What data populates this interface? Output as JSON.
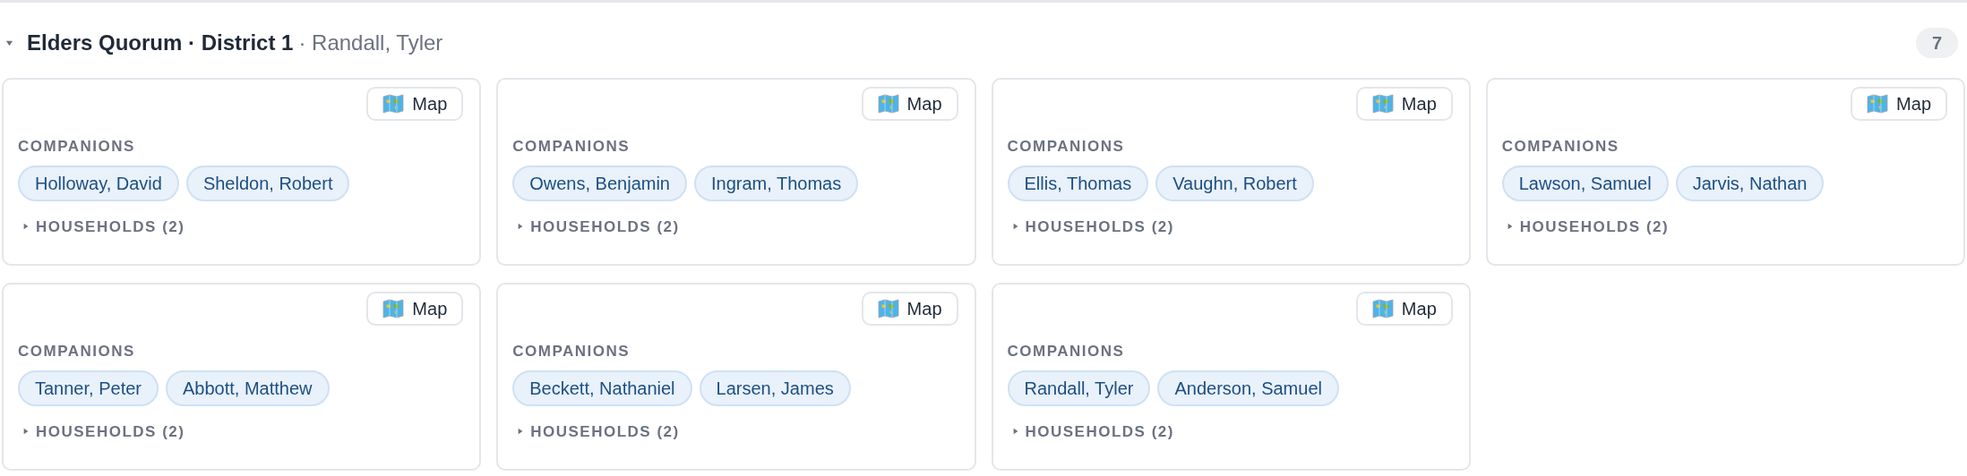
{
  "group": {
    "expanded": true,
    "title": "Elders Quorum · District 1",
    "leader": "· Randall, Tyler",
    "count": "7"
  },
  "cards": [
    {
      "map_label": "Map",
      "companions_label": "COMPANIONS",
      "companions": [
        "Holloway, David",
        "Sheldon, Robert"
      ],
      "households": {
        "label": "HOUSEHOLDS (2)",
        "expanded": false
      }
    },
    {
      "map_label": "Map",
      "companions_label": "COMPANIONS",
      "companions": [
        "Owens, Benjamin",
        "Ingram, Thomas"
      ],
      "households": {
        "label": "HOUSEHOLDS (2)",
        "expanded": false
      }
    },
    {
      "map_label": "Map",
      "companions_label": "COMPANIONS",
      "companions": [
        "Ellis, Thomas",
        "Vaughn, Robert"
      ],
      "households": {
        "label": "HOUSEHOLDS (2)",
        "expanded": false
      }
    },
    {
      "map_label": "Map",
      "companions_label": "COMPANIONS",
      "companions": [
        "Lawson, Samuel",
        "Jarvis, Nathan"
      ],
      "households": {
        "label": "HOUSEHOLDS (2)",
        "expanded": false
      }
    },
    {
      "map_label": "Map",
      "companions_label": "COMPANIONS",
      "companions": [
        "Tanner, Peter",
        "Abbott, Matthew"
      ],
      "households": {
        "label": "HOUSEHOLDS (2)",
        "expanded": false
      }
    },
    {
      "map_label": "Map",
      "companions_label": "COMPANIONS",
      "companions": [
        "Beckett, Nathaniel",
        "Larsen, James"
      ],
      "households": {
        "label": "HOUSEHOLDS (2)",
        "expanded": false
      }
    },
    {
      "map_label": "Map",
      "companions_label": "COMPANIONS",
      "companions": [
        "Randall, Tyler",
        "Anderson, Samuel"
      ],
      "households": {
        "label": "HOUSEHOLDS (2)",
        "expanded": false
      }
    }
  ]
}
